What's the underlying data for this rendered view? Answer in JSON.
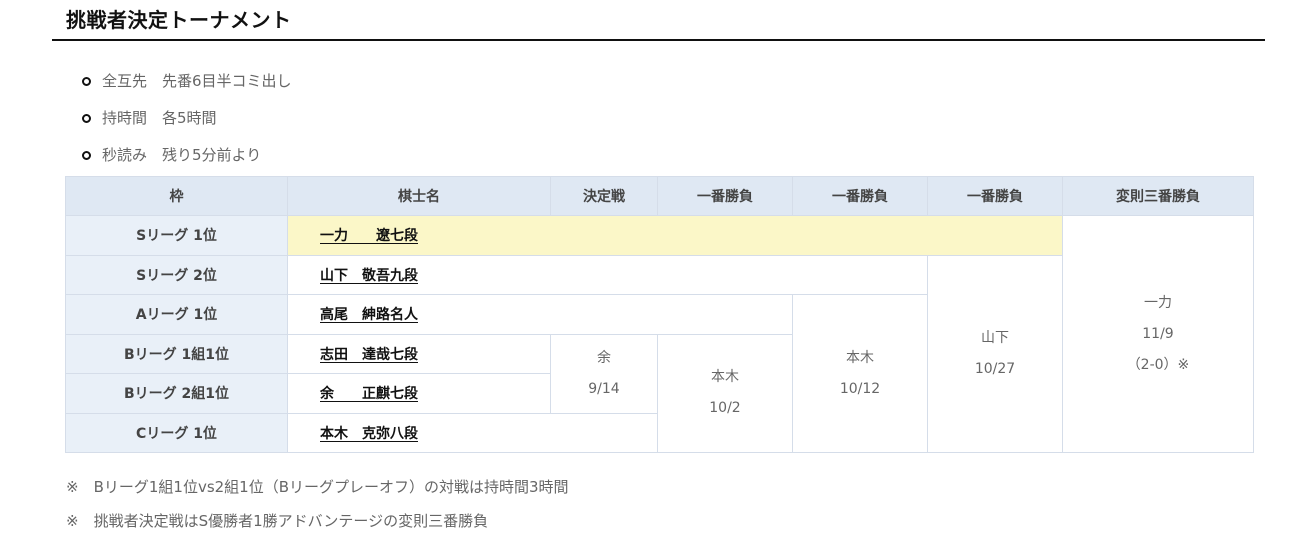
{
  "title": "挑戦者決定トーナメント",
  "rules": [
    "全互先　先番6目半コミ出し",
    "持時間　各5時間",
    "秒読み　残り5分前より"
  ],
  "table": {
    "headers": [
      "枠",
      "棋士名",
      "決定戦",
      "一番勝負",
      "一番勝負",
      "一番勝負",
      "変則三番勝負"
    ],
    "rows": [
      {
        "slot": "Sリーグ 1位",
        "player": "一力　　遼七段"
      },
      {
        "slot": "Sリーグ 2位",
        "player": "山下　敬吾九段"
      },
      {
        "slot": "Aリーグ 1位",
        "player": "高尾　紳路名人"
      },
      {
        "slot": "Bリーグ 1組1位",
        "player": "志田　達哉七段"
      },
      {
        "slot": "Bリーグ 2組1位",
        "player": "余　　正麒七段"
      },
      {
        "slot": "Cリーグ 1位",
        "player": "本木　克弥八段"
      }
    ],
    "results": {
      "playoff": {
        "winner": "余",
        "date": "9/14"
      },
      "round1": {
        "winner": "本木",
        "date": "10/2"
      },
      "round2": {
        "winner": "本木",
        "date": "10/12"
      },
      "round3": {
        "winner": "山下",
        "date": "10/27"
      },
      "final": {
        "winner": "一力",
        "date": "11/9",
        "score": "（2-0）※"
      }
    }
  },
  "notes": [
    "※　Bリーグ1組1位vs2組1位（Bリーグプレーオフ）の対戦は持時間3時間",
    "※　挑戦者決定戦はS優勝者1勝アドバンテージの変則三番勝負"
  ]
}
